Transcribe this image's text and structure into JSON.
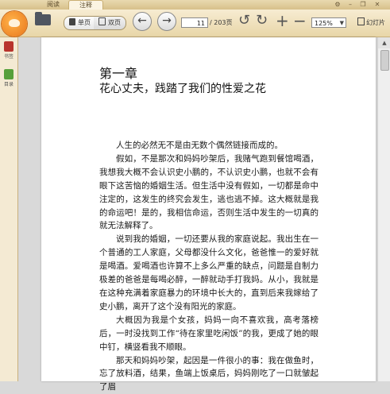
{
  "tabs": [
    {
      "label": "阅读"
    },
    {
      "label": "注释"
    }
  ],
  "toolbar": {
    "single_page": "单页",
    "double_page": "双页",
    "page_current": "11",
    "page_total": "/ 203页",
    "zoom": "125%",
    "slideshow": "幻灯片"
  },
  "sidebar": {
    "items": [
      {
        "label": "书签"
      },
      {
        "label": "目录"
      }
    ]
  },
  "page": {
    "chapter": "第一章",
    "title": "花心丈夫，践踏了我们的性爱之花",
    "paragraphs": [
      "人生的必然无不是由无数个偶然链接而成的。",
      "假如，不是那次和妈妈吵架后，我赌气跑到餐馆喝酒，我想我大概不会认识史小鹏的，不认识史小鹏，也就不会有眼下这苦恼的婚姻生活。但生活中没有假如，一切都是命中注定的，这发生的终究会发生，逃也逃不掉。这大概就是我的命运吧！是的，我相信命运，否则生活中发生的一切真的就无法解释了。",
      "说到我的婚姻，一切还要从我的家庭说起。我出生在一个普通的工人家庭，父母都没什么文化，爸爸惟一的爱好就是喝酒。爱喝酒也许算不上多么严重的缺点，问题是自制力极差的爸爸是每喝必醉，一醉就动手打我妈。从小，我就是在这种充满着家庭暴力的环境中长大的，直到后来我嫁给了史小鹏，离开了这个没有阳光的家庭。",
      "大概因为我是个女孩，妈妈一向不喜欢我，高考落榜后，一时没找到工作“待在家里吃闲饭”的我，更成了她的眼中钉，横竖看我不顺眼。",
      "那天和妈妈吵架，起因是一件很小的事：我在做鱼时，忘了放料酒，结果，鱼端上饭桌后，妈妈刚吃了一口就皱起了眉"
    ]
  }
}
